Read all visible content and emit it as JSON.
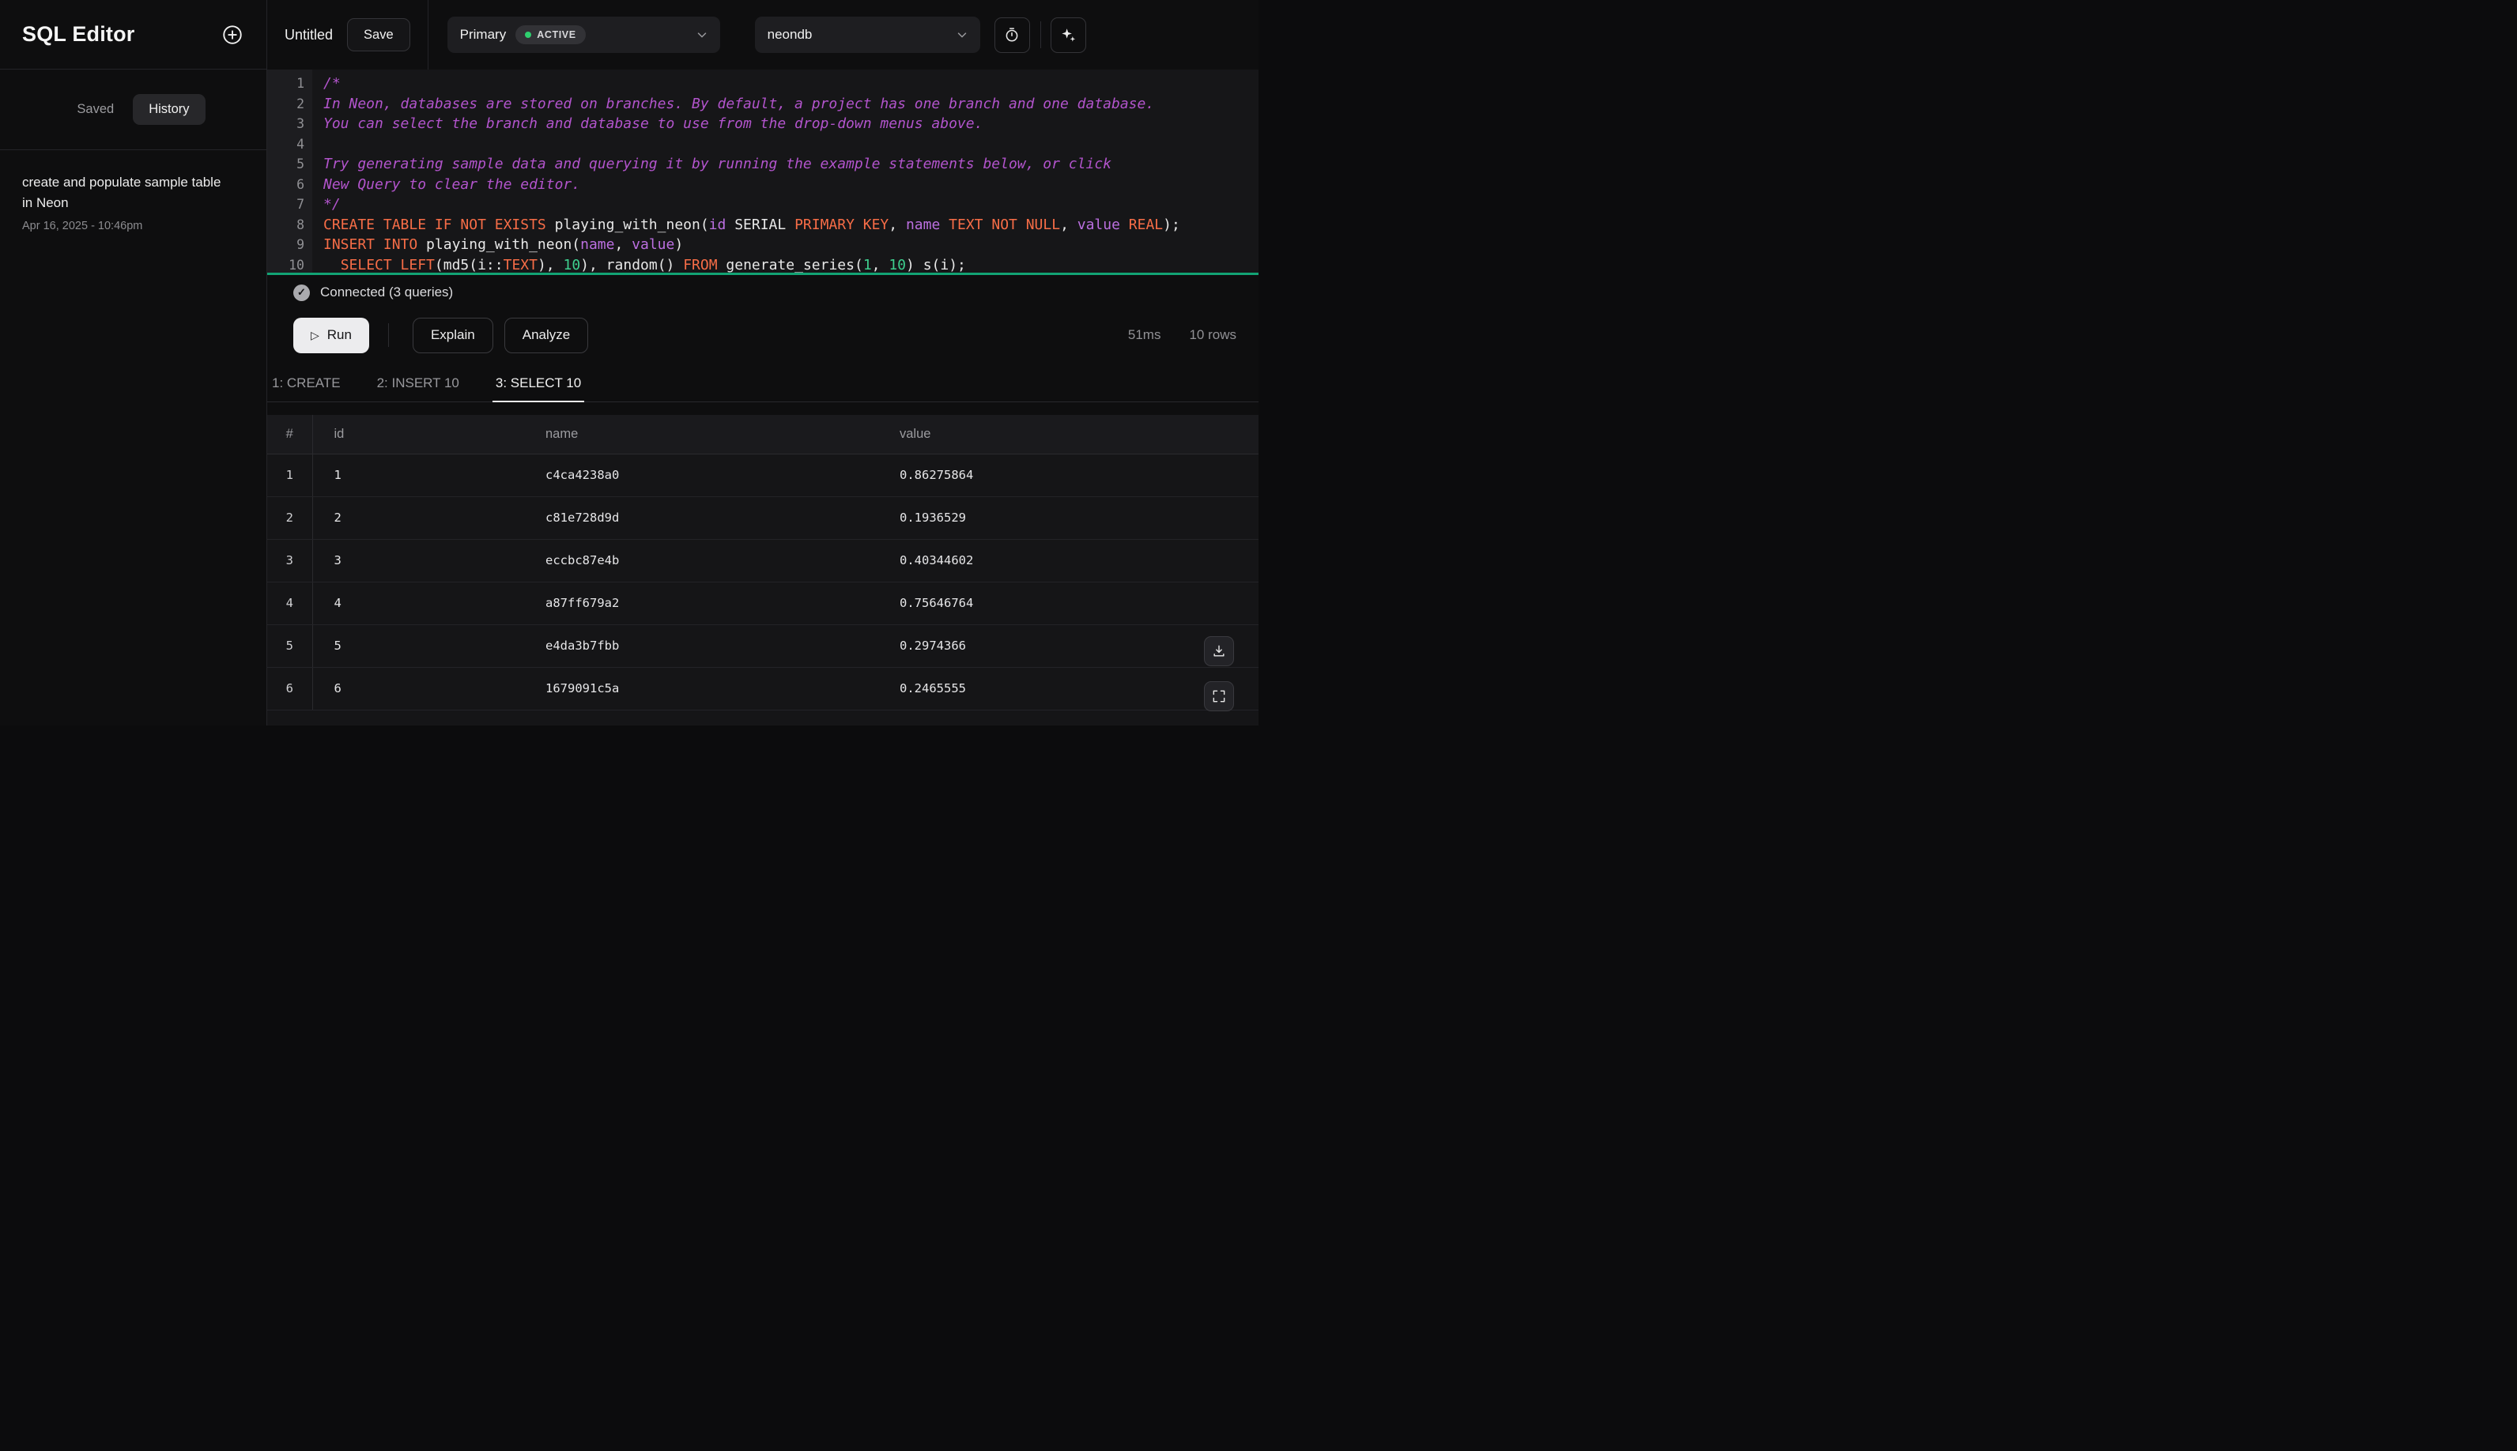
{
  "sidebar": {
    "title": "SQL Editor",
    "tabs": [
      {
        "label": "Saved",
        "active": false
      },
      {
        "label": "History",
        "active": true
      }
    ],
    "history_items": [
      {
        "title": "create and populate sample table in Neon",
        "date": "Apr 16, 2025 - 10:46pm"
      }
    ]
  },
  "topbar": {
    "file_name": "Untitled",
    "save_label": "Save",
    "branch": {
      "name": "Primary",
      "status": "ACTIVE"
    },
    "database": "neondb"
  },
  "editor": {
    "lines": [
      [
        [
          "comment",
          "/*"
        ]
      ],
      [
        [
          "comment",
          "In Neon, databases are stored on branches. By default, a project has one branch and one database."
        ]
      ],
      [
        [
          "comment",
          "You can select the branch and database to use from the drop-down menus above."
        ]
      ],
      [],
      [
        [
          "comment",
          "Try generating sample data and querying it by running the example statements below, or click"
        ]
      ],
      [
        [
          "comment",
          "New Query to clear the editor."
        ]
      ],
      [
        [
          "comment",
          "*/"
        ]
      ],
      [
        [
          "kw",
          "CREATE TABLE IF NOT EXISTS"
        ],
        [
          "plain",
          " playing_with_neon("
        ],
        [
          "ident",
          "id"
        ],
        [
          "plain",
          " SERIAL "
        ],
        [
          "kw",
          "PRIMARY KEY"
        ],
        [
          "plain",
          ", "
        ],
        [
          "ident",
          "name"
        ],
        [
          "plain",
          " "
        ],
        [
          "kw",
          "TEXT NOT NULL"
        ],
        [
          "plain",
          ", "
        ],
        [
          "ident",
          "value"
        ],
        [
          "plain",
          " "
        ],
        [
          "kw",
          "REAL"
        ],
        [
          "plain",
          ");"
        ]
      ],
      [
        [
          "kw",
          "INSERT INTO"
        ],
        [
          "plain",
          " playing_with_neon("
        ],
        [
          "ident",
          "name"
        ],
        [
          "plain",
          ", "
        ],
        [
          "ident",
          "value"
        ],
        [
          "plain",
          ")"
        ]
      ],
      [
        [
          "plain",
          "  "
        ],
        [
          "kw",
          "SELECT LEFT"
        ],
        [
          "plain",
          "(md5(i::"
        ],
        [
          "kw",
          "TEXT"
        ],
        [
          "plain",
          "), "
        ],
        [
          "num",
          "10"
        ],
        [
          "plain",
          "), random() "
        ],
        [
          "kw",
          "FROM"
        ],
        [
          "plain",
          " generate_series("
        ],
        [
          "num",
          "1"
        ],
        [
          "plain",
          ", "
        ],
        [
          "num",
          "10"
        ],
        [
          "plain",
          ") s(i);"
        ]
      ]
    ]
  },
  "status": {
    "connected_label": "Connected (3 queries)"
  },
  "toolbar": {
    "run": "Run",
    "explain": "Explain",
    "analyze": "Analyze",
    "duration": "51ms",
    "rows": "10 rows"
  },
  "results": {
    "tabs": [
      {
        "label": "1: CREATE",
        "active": false
      },
      {
        "label": "2: INSERT 10",
        "active": false
      },
      {
        "label": "3: SELECT 10",
        "active": true
      }
    ],
    "columns": [
      "#",
      "id",
      "name",
      "value"
    ],
    "rows": [
      [
        "1",
        "1",
        "c4ca4238a0",
        "0.86275864"
      ],
      [
        "2",
        "2",
        "c81e728d9d",
        "0.1936529"
      ],
      [
        "3",
        "3",
        "eccbc87e4b",
        "0.40344602"
      ],
      [
        "4",
        "4",
        "a87ff679a2",
        "0.75646764"
      ],
      [
        "5",
        "5",
        "e4da3b7fbb",
        "0.2974366"
      ],
      [
        "6",
        "6",
        "1679091c5a",
        "0.2465555"
      ]
    ]
  },
  "colors": {
    "accent_green": "#00e599",
    "status_active_dot": "#2ecf6e",
    "editor_divider_green": "#12a374",
    "syntax_keyword": "#f76d47",
    "syntax_comment": "#b254cc",
    "syntax_ident": "#bb6fe0",
    "syntax_number": "#3ecf8e"
  }
}
